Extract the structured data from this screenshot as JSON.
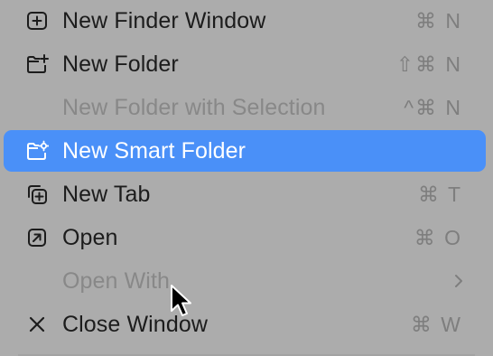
{
  "menu": {
    "items": [
      {
        "label": "New Finder Window",
        "shortcut": "⌘ N",
        "icon": "new-window-icon",
        "state": "normal"
      },
      {
        "label": "New Folder",
        "shortcut": "⇧⌘ N",
        "icon": "folder-plus-icon",
        "state": "normal"
      },
      {
        "label": "New Folder with Selection",
        "shortcut": "^⌘ N",
        "icon": "",
        "state": "disabled"
      },
      {
        "label": "New Smart Folder",
        "shortcut": "",
        "icon": "smart-folder-icon",
        "state": "highlighted"
      },
      {
        "label": "New Tab",
        "shortcut": "⌘ T",
        "icon": "new-tab-icon",
        "state": "normal"
      },
      {
        "label": "Open",
        "shortcut": "⌘ O",
        "icon": "open-arrow-icon",
        "state": "normal"
      },
      {
        "label": "Open With",
        "shortcut": "",
        "icon": "",
        "state": "disabled",
        "submenu": "chevron-right-icon"
      },
      {
        "label": "Close Window",
        "shortcut": "⌘ W",
        "icon": "close-x-icon",
        "state": "normal"
      }
    ]
  },
  "colors": {
    "menu_background": "#acacac",
    "highlight": "#4a90f8",
    "text": "#1c1c1c",
    "disabled_text": "#888888",
    "shortcut_text": "#7e7e7e"
  },
  "cursor": "arrow-pointer-icon"
}
